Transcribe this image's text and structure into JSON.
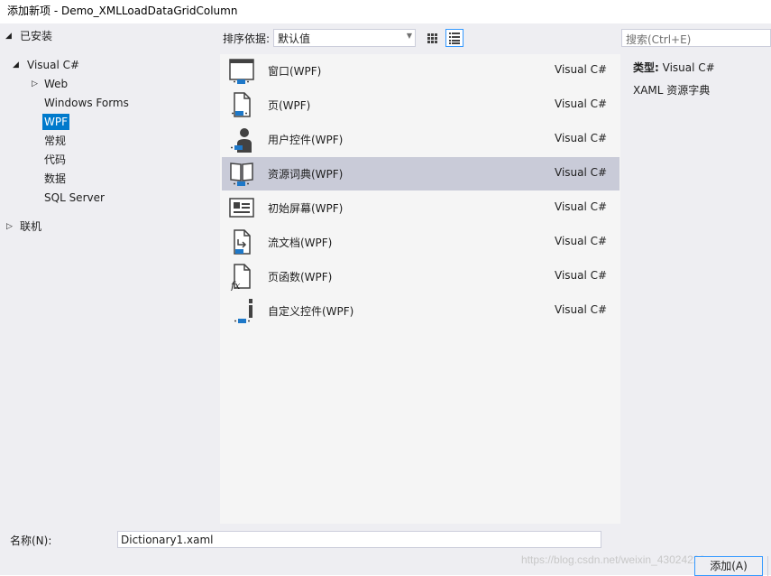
{
  "window": {
    "title": "添加新项 - Demo_XMLLoadDataGridColumn"
  },
  "tree": {
    "installed": "已安装",
    "visual_csharp": "Visual C#",
    "web": "Web",
    "windows_forms": "Windows Forms",
    "wpf": "WPF",
    "general": "常规",
    "code": "代码",
    "data": "数据",
    "sql_server": "SQL Server",
    "online": "联机"
  },
  "toolbar": {
    "sort_label": "排序依据:",
    "sort_value": "默认值"
  },
  "search": {
    "placeholder": "搜索(Ctrl+E)"
  },
  "templates": [
    {
      "name": "窗口(WPF)",
      "lang": "Visual C#",
      "icon": "window-icon"
    },
    {
      "name": "页(WPF)",
      "lang": "Visual C#",
      "icon": "page-icon"
    },
    {
      "name": "用户控件(WPF)",
      "lang": "Visual C#",
      "icon": "user-control-icon"
    },
    {
      "name": "资源词典(WPF)",
      "lang": "Visual C#",
      "icon": "resource-dictionary-icon",
      "selected": true
    },
    {
      "name": "初始屏幕(WPF)",
      "lang": "Visual C#",
      "icon": "splash-screen-icon"
    },
    {
      "name": "流文档(WPF)",
      "lang": "Visual C#",
      "icon": "flow-document-icon"
    },
    {
      "name": "页函数(WPF)",
      "lang": "Visual C#",
      "icon": "page-function-icon"
    },
    {
      "name": "自定义控件(WPF)",
      "lang": "Visual C#",
      "icon": "custom-control-icon"
    }
  ],
  "info": {
    "type_label": "类型:",
    "type_value": "Visual C#",
    "description": "XAML 资源字典"
  },
  "bottom": {
    "name_label": "名称(N):",
    "name_value": "Dictionary1.xaml",
    "add_button": "添加(A)",
    "watermark": "https://blog.csdn.net/weixin_43024229"
  },
  "colors": {
    "selection": "#007acc",
    "row_selected": "#c9cbd8",
    "accent_blue": "#1e78c8"
  }
}
